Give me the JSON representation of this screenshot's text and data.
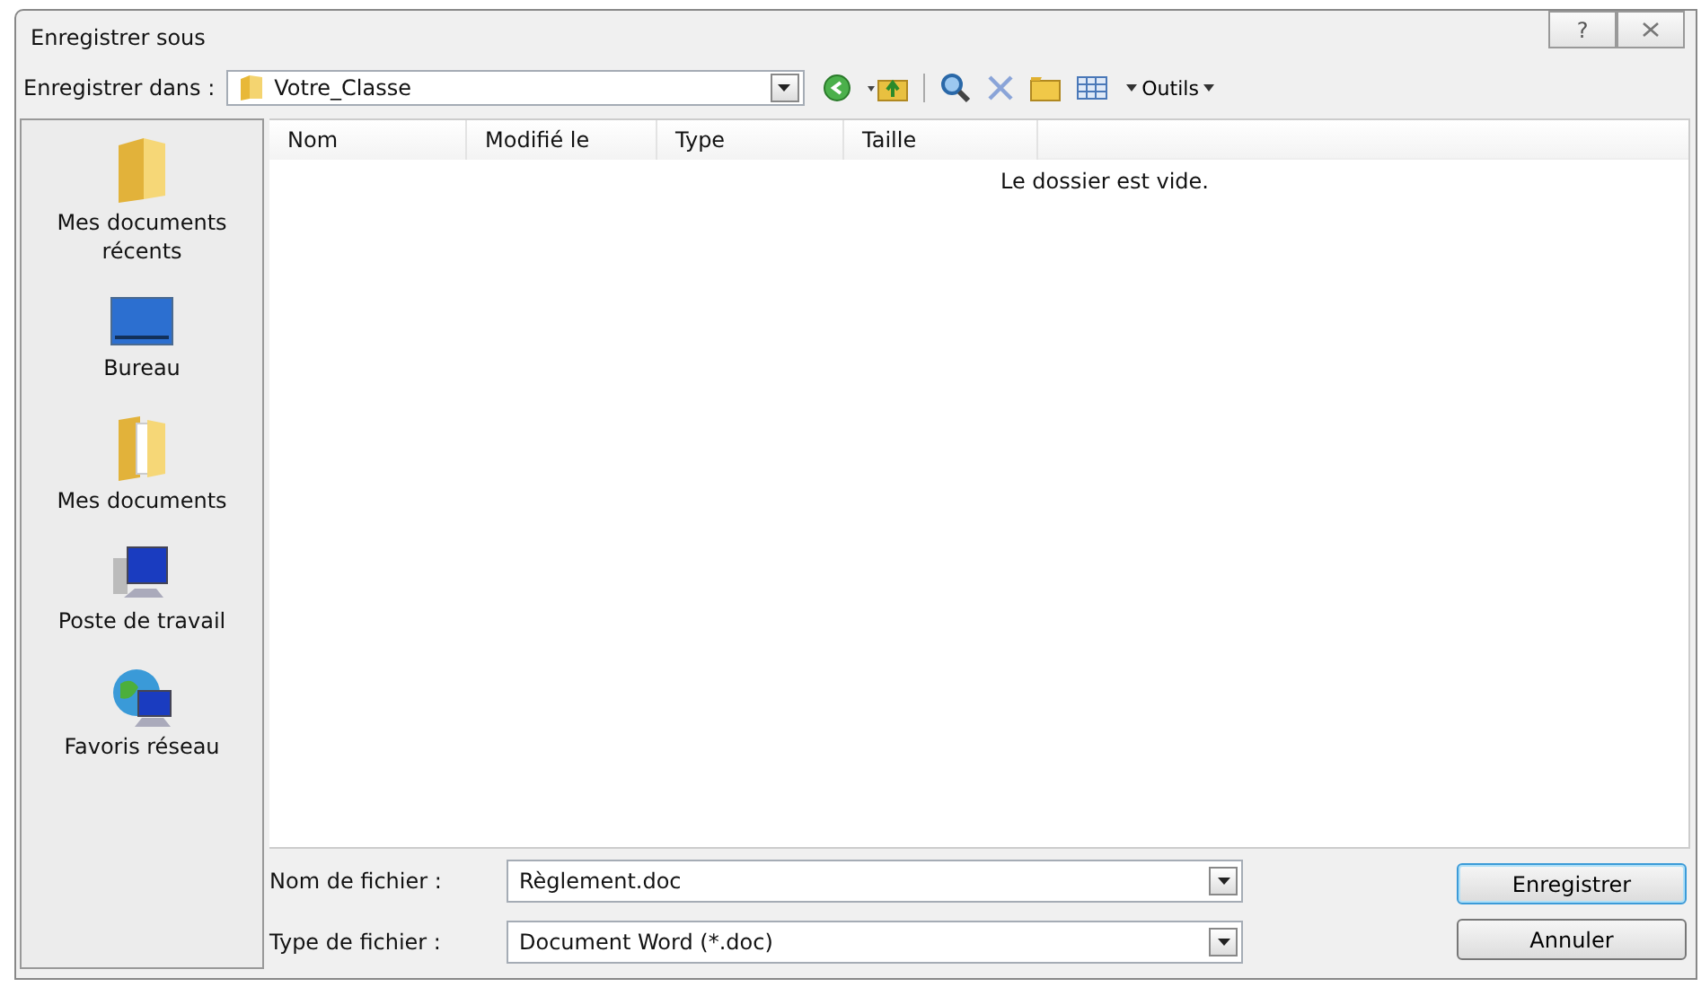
{
  "window": {
    "title": "Enregistrer sous",
    "help": "?"
  },
  "location": {
    "label": "Enregistrer dans :",
    "value": "Votre_Classe"
  },
  "toolbar": {
    "tools_label": "Outils"
  },
  "places": [
    {
      "label": "Mes documents récents",
      "kind": "recent"
    },
    {
      "label": "Bureau",
      "kind": "desktop"
    },
    {
      "label": "Mes documents",
      "kind": "documents"
    },
    {
      "label": "Poste de travail",
      "kind": "computer"
    },
    {
      "label": "Favoris réseau",
      "kind": "network"
    }
  ],
  "table": {
    "columns": [
      "Nom",
      "Modifié le",
      "Type",
      "Taille"
    ],
    "empty_message": "Le dossier est vide."
  },
  "file_name": {
    "label": "Nom de fichier :",
    "value": "Règlement.doc"
  },
  "file_type": {
    "label": "Type de fichier :",
    "value": "Document Word (*.doc)"
  },
  "buttons": [
    {
      "label": "Enregistrer",
      "default": true
    },
    {
      "label": "Annuler",
      "default": false
    }
  ]
}
